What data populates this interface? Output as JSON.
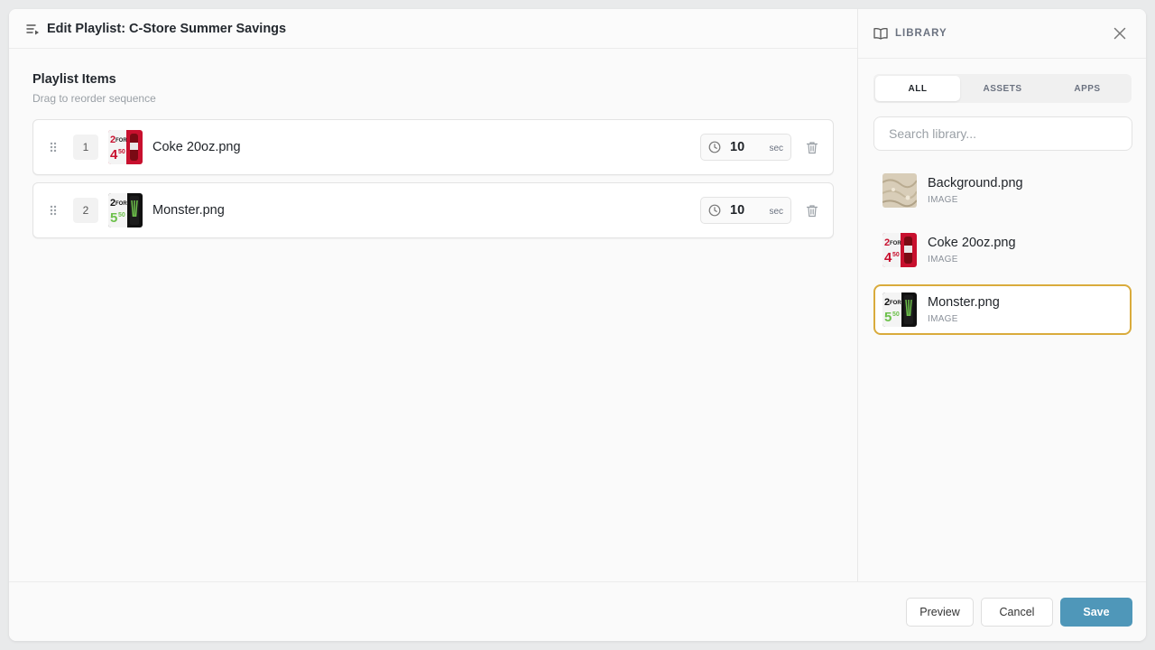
{
  "header": {
    "title": "Edit Playlist: C-Store Summer Savings",
    "icon": "playlist-icon"
  },
  "playlist": {
    "title": "Playlist Items",
    "subtitle": "Drag to reorder sequence",
    "items": [
      {
        "index": "1",
        "name": "Coke 20oz.png",
        "duration": "10",
        "unit": "sec",
        "thumb": "coke"
      },
      {
        "index": "2",
        "name": "Monster.png",
        "duration": "10",
        "unit": "sec",
        "thumb": "monster"
      }
    ]
  },
  "library": {
    "title": "LIBRARY",
    "tabs": [
      {
        "label": "ALL",
        "active": true
      },
      {
        "label": "ASSETS"
      },
      {
        "label": "APPS"
      }
    ],
    "search_placeholder": "Search library...",
    "items": [
      {
        "name": "Background.png",
        "type": "IMAGE",
        "thumb": "background"
      },
      {
        "name": "Coke 20oz.png",
        "type": "IMAGE",
        "thumb": "coke"
      },
      {
        "name": "Monster.png",
        "type": "IMAGE",
        "thumb": "monster",
        "selected": true
      }
    ]
  },
  "footer": {
    "preview_label": "Preview",
    "cancel_label": "Cancel",
    "save_label": "Save"
  },
  "colors": {
    "accent": "#4f97b9",
    "selected_border": "#d9ab3c"
  }
}
